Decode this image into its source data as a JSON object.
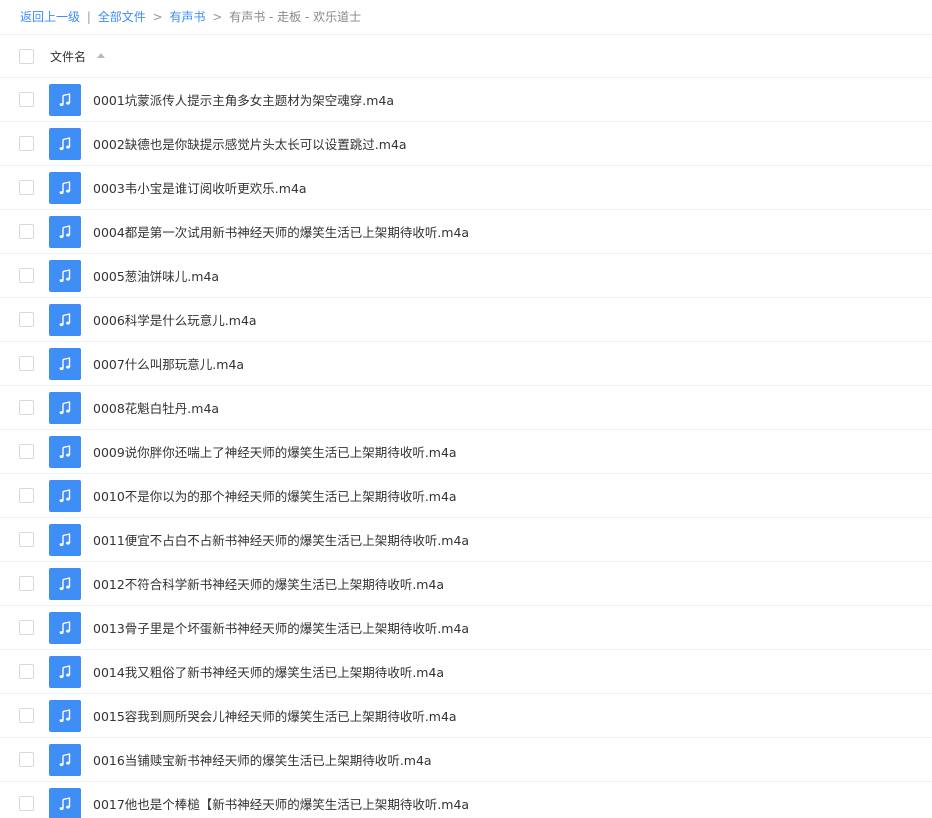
{
  "breadcrumb": {
    "back": "返回上一级",
    "separator": "|",
    "all_files": "全部文件",
    "arrow": ">",
    "level1": "有声书",
    "current": "有声书 - 走板 - 欢乐道士"
  },
  "table": {
    "header": {
      "column_filename": "文件名",
      "sort_icon": "sort-ascending-icon"
    },
    "file_icon": "music-note-icon",
    "files": [
      {
        "name": "0001坑蒙派传人提示主角多女主题材为架空魂穿.m4a"
      },
      {
        "name": "0002缺德也是你缺提示感觉片头太长可以设置跳过.m4a"
      },
      {
        "name": "0003韦小宝是谁订阅收听更欢乐.m4a"
      },
      {
        "name": "0004都是第一次试用新书神经天师的爆笑生活已上架期待收听.m4a"
      },
      {
        "name": "0005葱油饼味儿.m4a"
      },
      {
        "name": "0006科学是什么玩意儿.m4a"
      },
      {
        "name": "0007什么叫那玩意儿.m4a"
      },
      {
        "name": "0008花魁白牡丹.m4a"
      },
      {
        "name": "0009说你胖你还喘上了神经天师的爆笑生活已上架期待收听.m4a"
      },
      {
        "name": "0010不是你以为的那个神经天师的爆笑生活已上架期待收听.m4a"
      },
      {
        "name": "0011便宜不占白不占新书神经天师的爆笑生活已上架期待收听.m4a"
      },
      {
        "name": "0012不符合科学新书神经天师的爆笑生活已上架期待收听.m4a"
      },
      {
        "name": "0013骨子里是个坏蛋新书神经天师的爆笑生活已上架期待收听.m4a"
      },
      {
        "name": "0014我又粗俗了新书神经天师的爆笑生活已上架期待收听.m4a"
      },
      {
        "name": "0015容我到厕所哭会儿神经天师的爆笑生活已上架期待收听.m4a"
      },
      {
        "name": "0016当铺赎宝新书神经天师的爆笑生活已上架期待收听.m4a"
      },
      {
        "name": "0017他也是个棒槌【新书神经天师的爆笑生活已上架期待收听.m4a"
      }
    ]
  }
}
